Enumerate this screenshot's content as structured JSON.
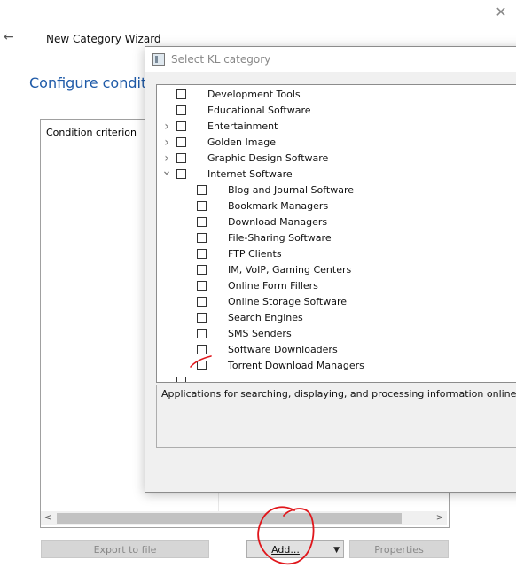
{
  "wizard": {
    "title": "New Category Wizard",
    "heading": "Configure conditions",
    "close_glyph": "✕",
    "back_glyph": "←",
    "criterion_label": "Condition criterion",
    "buttons": {
      "export": "Export to file",
      "add": "Add...",
      "properties": "Properties"
    }
  },
  "dialog": {
    "title": "Select KL category",
    "tree": [
      {
        "label": "Development Tools",
        "level": 0,
        "expander": ""
      },
      {
        "label": "Educational Software",
        "level": 0,
        "expander": ""
      },
      {
        "label": "Entertainment",
        "level": 0,
        "expander": ">"
      },
      {
        "label": "Golden Image",
        "level": 0,
        "expander": ">"
      },
      {
        "label": "Graphic Design Software",
        "level": 0,
        "expander": ">"
      },
      {
        "label": "Internet Software",
        "level": 0,
        "expander": "v"
      },
      {
        "label": "Blog and Journal Software",
        "level": 1,
        "expander": ""
      },
      {
        "label": "Bookmark Managers",
        "level": 1,
        "expander": ""
      },
      {
        "label": "Download Managers",
        "level": 1,
        "expander": ""
      },
      {
        "label": "File-Sharing Software",
        "level": 1,
        "expander": ""
      },
      {
        "label": "FTP Clients",
        "level": 1,
        "expander": ""
      },
      {
        "label": "IM, VoIP, Gaming Centers",
        "level": 1,
        "expander": ""
      },
      {
        "label": "Online Form Fillers",
        "level": 1,
        "expander": ""
      },
      {
        "label": "Online Storage Software",
        "level": 1,
        "expander": ""
      },
      {
        "label": "Search Engines",
        "level": 1,
        "expander": ""
      },
      {
        "label": "SMS Senders",
        "level": 1,
        "expander": ""
      },
      {
        "label": "Software Downloaders",
        "level": 1,
        "expander": ""
      },
      {
        "label": "Torrent Download Managers",
        "level": 1,
        "expander": ""
      },
      {
        "label": "",
        "level": 0,
        "expander": ""
      }
    ],
    "description": "Applications for searching, displaying, and processing information online"
  },
  "colors": {
    "heading": "#1e5aa8",
    "annotation": "#e0161b"
  }
}
